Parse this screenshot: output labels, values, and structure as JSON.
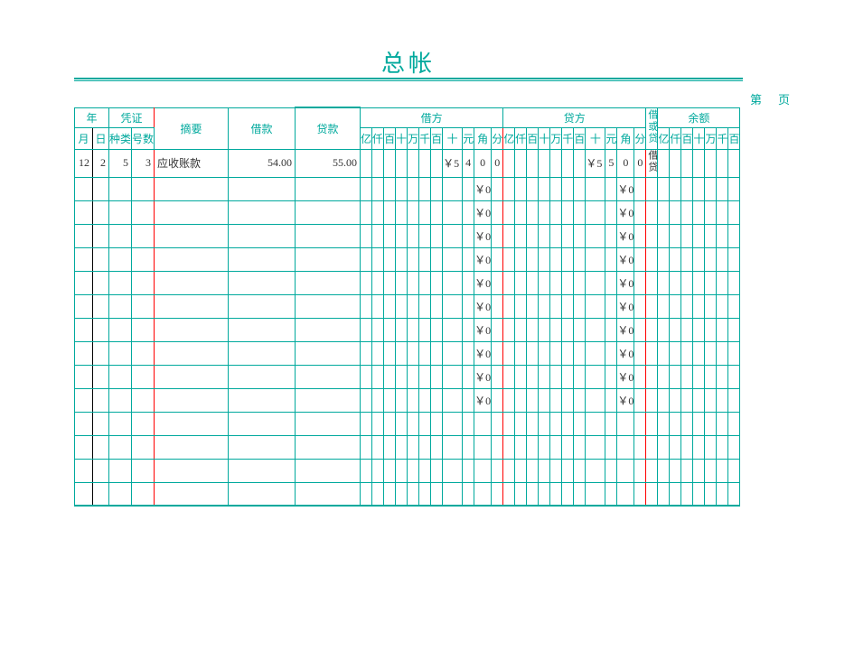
{
  "title": "总帐",
  "page_label": "第页",
  "header": {
    "year": "年",
    "month": "月",
    "day": "日",
    "voucher": "凭证",
    "voucher_kind": "种类",
    "voucher_num": "号数",
    "summary": "摘要",
    "debit_label": "借款",
    "credit_label": "贷款",
    "debit_side": "借方",
    "credit_side": "贷方",
    "flag": "借或贷",
    "balance": "余额",
    "digits": [
      "亿",
      "仟",
      "百",
      "十",
      "万",
      "千",
      "百",
      "十",
      "元",
      "角",
      "分"
    ],
    "digits7": [
      "亿",
      "仟",
      "百",
      "十",
      "万",
      "千",
      "百"
    ]
  },
  "rows": [
    {
      "month": "12",
      "day": "2",
      "kind": "5",
      "num": "3",
      "summary": "应收账款",
      "debit": "54.00",
      "credit": "55.00",
      "dq": [
        "",
        "",
        "",
        "",
        "",
        "",
        "",
        "￥5",
        "4",
        "0",
        "0"
      ],
      "cq": [
        "",
        "",
        "",
        "",
        "",
        "",
        "",
        "￥5",
        "5",
        "0",
        "0"
      ],
      "flag": "借贷",
      "bal": [
        "",
        "",
        "",
        "",
        "",
        "",
        ""
      ]
    },
    {
      "month": "",
      "day": "",
      "kind": "",
      "num": "",
      "summary": "",
      "debit": "",
      "credit": "",
      "dq": [
        "",
        "",
        "",
        "",
        "",
        "",
        "",
        "",
        "",
        "￥0",
        ""
      ],
      "cq": [
        "",
        "",
        "",
        "",
        "",
        "",
        "",
        "",
        "",
        "￥0",
        ""
      ],
      "flag": "",
      "bal": [
        "",
        "",
        "",
        "",
        "",
        "",
        ""
      ]
    },
    {
      "month": "",
      "day": "",
      "kind": "",
      "num": "",
      "summary": "",
      "debit": "",
      "credit": "",
      "dq": [
        "",
        "",
        "",
        "",
        "",
        "",
        "",
        "",
        "",
        "￥0",
        ""
      ],
      "cq": [
        "",
        "",
        "",
        "",
        "",
        "",
        "",
        "",
        "",
        "￥0",
        ""
      ],
      "flag": "",
      "bal": [
        "",
        "",
        "",
        "",
        "",
        "",
        ""
      ]
    },
    {
      "month": "",
      "day": "",
      "kind": "",
      "num": "",
      "summary": "",
      "debit": "",
      "credit": "",
      "dq": [
        "",
        "",
        "",
        "",
        "",
        "",
        "",
        "",
        "",
        "￥0",
        ""
      ],
      "cq": [
        "",
        "",
        "",
        "",
        "",
        "",
        "",
        "",
        "",
        "￥0",
        ""
      ],
      "flag": "",
      "bal": [
        "",
        "",
        "",
        "",
        "",
        "",
        ""
      ]
    },
    {
      "month": "",
      "day": "",
      "kind": "",
      "num": "",
      "summary": "",
      "debit": "",
      "credit": "",
      "dq": [
        "",
        "",
        "",
        "",
        "",
        "",
        "",
        "",
        "",
        "￥0",
        ""
      ],
      "cq": [
        "",
        "",
        "",
        "",
        "",
        "",
        "",
        "",
        "",
        "￥0",
        ""
      ],
      "flag": "",
      "bal": [
        "",
        "",
        "",
        "",
        "",
        "",
        ""
      ]
    },
    {
      "month": "",
      "day": "",
      "kind": "",
      "num": "",
      "summary": "",
      "debit": "",
      "credit": "",
      "dq": [
        "",
        "",
        "",
        "",
        "",
        "",
        "",
        "",
        "",
        "￥0",
        ""
      ],
      "cq": [
        "",
        "",
        "",
        "",
        "",
        "",
        "",
        "",
        "",
        "￥0",
        ""
      ],
      "flag": "",
      "bal": [
        "",
        "",
        "",
        "",
        "",
        "",
        ""
      ]
    },
    {
      "month": "",
      "day": "",
      "kind": "",
      "num": "",
      "summary": "",
      "debit": "",
      "credit": "",
      "dq": [
        "",
        "",
        "",
        "",
        "",
        "",
        "",
        "",
        "",
        "￥0",
        ""
      ],
      "cq": [
        "",
        "",
        "",
        "",
        "",
        "",
        "",
        "",
        "",
        "￥0",
        ""
      ],
      "flag": "",
      "bal": [
        "",
        "",
        "",
        "",
        "",
        "",
        ""
      ]
    },
    {
      "month": "",
      "day": "",
      "kind": "",
      "num": "",
      "summary": "",
      "debit": "",
      "credit": "",
      "dq": [
        "",
        "",
        "",
        "",
        "",
        "",
        "",
        "",
        "",
        "￥0",
        ""
      ],
      "cq": [
        "",
        "",
        "",
        "",
        "",
        "",
        "",
        "",
        "",
        "￥0",
        ""
      ],
      "flag": "",
      "bal": [
        "",
        "",
        "",
        "",
        "",
        "",
        ""
      ]
    },
    {
      "month": "",
      "day": "",
      "kind": "",
      "num": "",
      "summary": "",
      "debit": "",
      "credit": "",
      "dq": [
        "",
        "",
        "",
        "",
        "",
        "",
        "",
        "",
        "",
        "￥0",
        ""
      ],
      "cq": [
        "",
        "",
        "",
        "",
        "",
        "",
        "",
        "",
        "",
        "￥0",
        ""
      ],
      "flag": "",
      "bal": [
        "",
        "",
        "",
        "",
        "",
        "",
        ""
      ]
    },
    {
      "month": "",
      "day": "",
      "kind": "",
      "num": "",
      "summary": "",
      "debit": "",
      "credit": "",
      "dq": [
        "",
        "",
        "",
        "",
        "",
        "",
        "",
        "",
        "",
        "￥0",
        ""
      ],
      "cq": [
        "",
        "",
        "",
        "",
        "",
        "",
        "",
        "",
        "",
        "￥0",
        ""
      ],
      "flag": "",
      "bal": [
        "",
        "",
        "",
        "",
        "",
        "",
        ""
      ]
    },
    {
      "month": "",
      "day": "",
      "kind": "",
      "num": "",
      "summary": "",
      "debit": "",
      "credit": "",
      "dq": [
        "",
        "",
        "",
        "",
        "",
        "",
        "",
        "",
        "",
        "￥0",
        ""
      ],
      "cq": [
        "",
        "",
        "",
        "",
        "",
        "",
        "",
        "",
        "",
        "￥0",
        ""
      ],
      "flag": "",
      "bal": [
        "",
        "",
        "",
        "",
        "",
        "",
        ""
      ]
    },
    {
      "month": "",
      "day": "",
      "kind": "",
      "num": "",
      "summary": "",
      "debit": "",
      "credit": "",
      "dq": [
        "",
        "",
        "",
        "",
        "",
        "",
        "",
        "",
        "",
        "",
        ""
      ],
      "cq": [
        "",
        "",
        "",
        "",
        "",
        "",
        "",
        "",
        "",
        "",
        ""
      ],
      "flag": "",
      "bal": [
        "",
        "",
        "",
        "",
        "",
        "",
        ""
      ]
    },
    {
      "month": "",
      "day": "",
      "kind": "",
      "num": "",
      "summary": "",
      "debit": "",
      "credit": "",
      "dq": [
        "",
        "",
        "",
        "",
        "",
        "",
        "",
        "",
        "",
        "",
        ""
      ],
      "cq": [
        "",
        "",
        "",
        "",
        "",
        "",
        "",
        "",
        "",
        "",
        ""
      ],
      "flag": "",
      "bal": [
        "",
        "",
        "",
        "",
        "",
        "",
        ""
      ]
    },
    {
      "month": "",
      "day": "",
      "kind": "",
      "num": "",
      "summary": "",
      "debit": "",
      "credit": "",
      "dq": [
        "",
        "",
        "",
        "",
        "",
        "",
        "",
        "",
        "",
        "",
        ""
      ],
      "cq": [
        "",
        "",
        "",
        "",
        "",
        "",
        "",
        "",
        "",
        "",
        ""
      ],
      "flag": "",
      "bal": [
        "",
        "",
        "",
        "",
        "",
        "",
        ""
      ]
    },
    {
      "month": "",
      "day": "",
      "kind": "",
      "num": "",
      "summary": "",
      "debit": "",
      "credit": "",
      "dq": [
        "",
        "",
        "",
        "",
        "",
        "",
        "",
        "",
        "",
        "",
        ""
      ],
      "cq": [
        "",
        "",
        "",
        "",
        "",
        "",
        "",
        "",
        "",
        "",
        ""
      ],
      "flag": "",
      "bal": [
        "",
        "",
        "",
        "",
        "",
        "",
        ""
      ]
    }
  ]
}
